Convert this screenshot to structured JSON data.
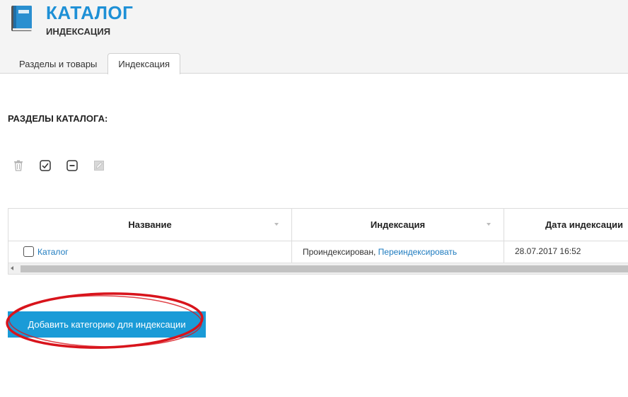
{
  "header": {
    "title": "КАТАЛОГ",
    "subtitle": "ИНДЕКСАЦИЯ",
    "icon": "book-icon"
  },
  "tabs": [
    {
      "label": "Разделы и товары",
      "active": false
    },
    {
      "label": "Индексация",
      "active": true
    }
  ],
  "section": {
    "title": "РАЗДЕЛЫ КАТАЛОГА:"
  },
  "toolbar": {
    "icons": [
      "trash-icon",
      "check-square-icon",
      "minus-square-icon",
      "edit-square-icon"
    ]
  },
  "table": {
    "columns": [
      "Название",
      "Индексация",
      "Дата индексации"
    ],
    "rows": [
      {
        "name": "Каталог",
        "status": "Проиндексирован,",
        "action": "Переиндексировать",
        "date": "28.07.2017 16:52"
      }
    ]
  },
  "add_button": {
    "label": "Добавить категорию для индексации"
  },
  "colors": {
    "accent": "#1a9bd7",
    "title": "#1e90d6",
    "link": "#1e7bbf",
    "annotation": "#d8141c"
  }
}
